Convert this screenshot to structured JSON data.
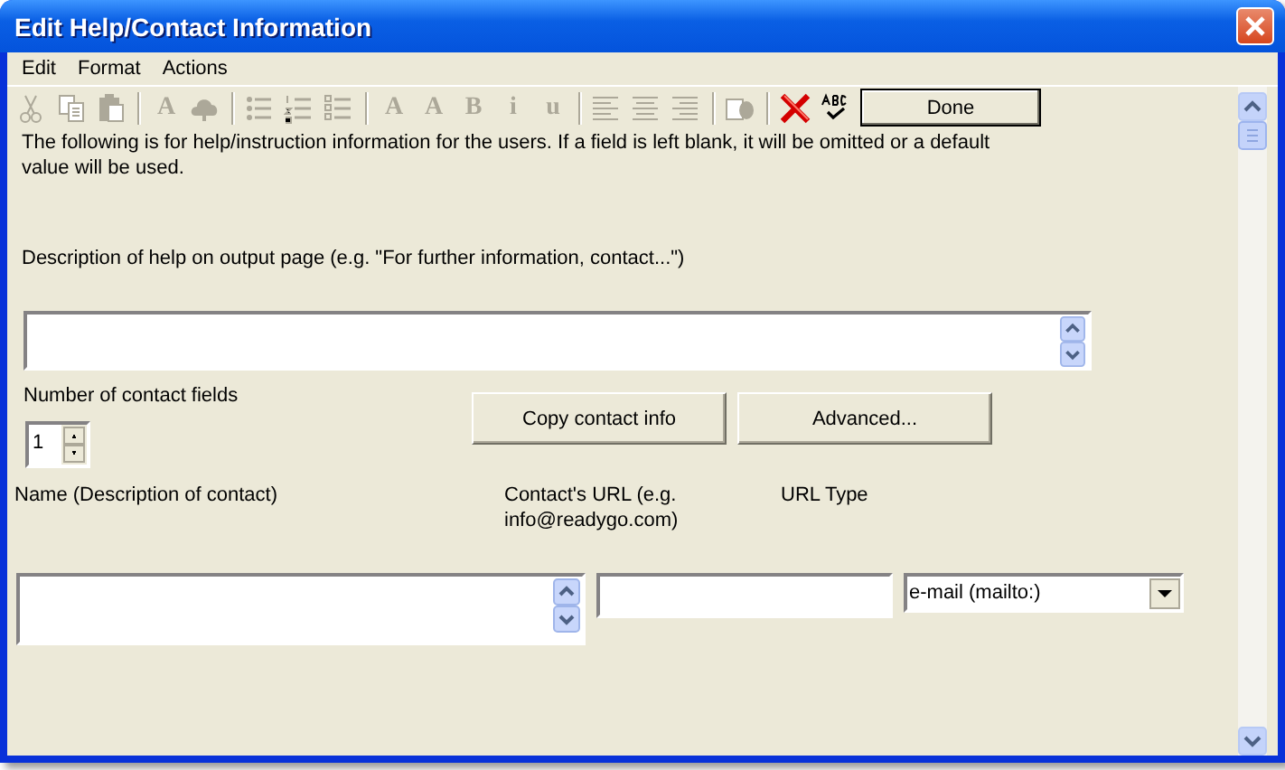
{
  "window": {
    "title": "Edit Help/Contact Information"
  },
  "menu": [
    {
      "label": "Edit"
    },
    {
      "label": "Format"
    },
    {
      "label": "Actions"
    }
  ],
  "toolbar": [
    {
      "kind": "cut",
      "disabled": true
    },
    {
      "kind": "copy",
      "disabled": true
    },
    {
      "kind": "paste",
      "disabled": true
    },
    {
      "kind": "separator"
    },
    {
      "kind": "letter",
      "glyph": "A",
      "disabled": true
    },
    {
      "kind": "color",
      "disabled": true
    },
    {
      "kind": "separator"
    },
    {
      "kind": "bullets",
      "disabled": true
    },
    {
      "kind": "numbers",
      "disabled": true
    },
    {
      "kind": "checklist",
      "disabled": true
    },
    {
      "kind": "separator"
    },
    {
      "kind": "letter",
      "glyph": "A",
      "disabled": true
    },
    {
      "kind": "letter",
      "glyph": "A",
      "disabled": true
    },
    {
      "kind": "letter",
      "glyph": "B",
      "disabled": true
    },
    {
      "kind": "letter",
      "glyph": "i",
      "disabled": true
    },
    {
      "kind": "letter",
      "glyph": "u",
      "disabled": true
    },
    {
      "kind": "separator"
    },
    {
      "kind": "align-left",
      "disabled": true
    },
    {
      "kind": "align-center",
      "disabled": true
    },
    {
      "kind": "align-right",
      "disabled": true
    },
    {
      "kind": "separator"
    },
    {
      "kind": "insert",
      "disabled": true
    },
    {
      "kind": "separator"
    },
    {
      "kind": "delete",
      "disabled": false
    },
    {
      "kind": "spell",
      "disabled": false
    }
  ],
  "done_button": "Done",
  "intro": "The following is for help/instruction information for the users. If a field is left blank, it will be omitted or a default value will be used.",
  "description_label": "Description of help on output page (e.g. \"For further information, contact...\")",
  "contact_count": {
    "label": "Number of contact fields",
    "value": "1"
  },
  "buttons": [
    "Copy contact info",
    "Advanced..."
  ],
  "columns": [
    "Name (Description of contact)",
    "Contact's URL (e.g. info@readygo.com)",
    "URL Type"
  ],
  "contact": {
    "url_type": "e-mail (mailto:)"
  }
}
